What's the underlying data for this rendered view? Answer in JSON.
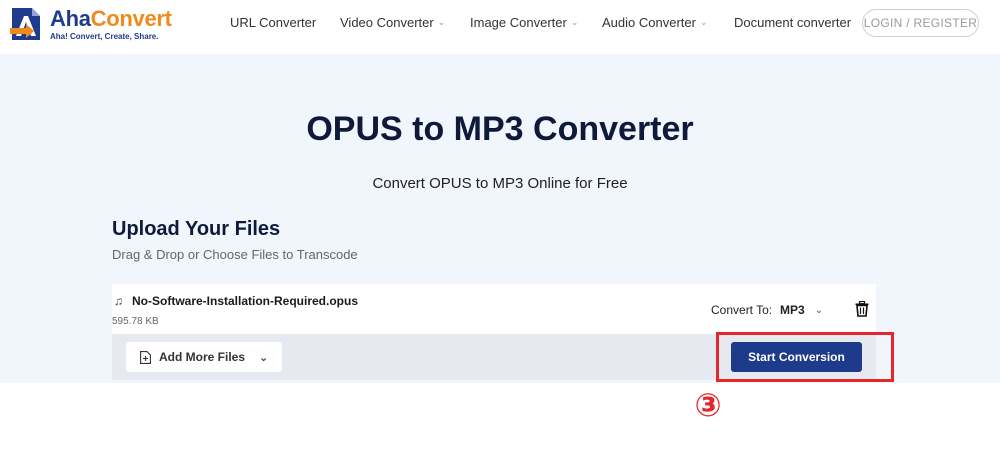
{
  "brand": {
    "name_part1": "Aha",
    "name_part2": "Convert",
    "tagline": "Aha! Convert, Create, Share."
  },
  "nav": {
    "items": [
      {
        "label": "URL Converter",
        "has_dropdown": false
      },
      {
        "label": "Video Converter",
        "has_dropdown": true
      },
      {
        "label": "Image Converter",
        "has_dropdown": true
      },
      {
        "label": "Audio Converter",
        "has_dropdown": true
      },
      {
        "label": "Document converter",
        "has_dropdown": false
      }
    ],
    "login_label": "LOGIN / REGISTER"
  },
  "hero": {
    "title": "OPUS to MP3 Converter",
    "subtitle": "Convert OPUS to MP3 Online for Free"
  },
  "upload": {
    "title": "Upload Your Files",
    "subtitle": "Drag & Drop or Choose Files to Transcode"
  },
  "file": {
    "name": "No-Software-Installation-Required.opus",
    "size": "595.78 KB",
    "convert_to_label": "Convert To:",
    "convert_to_value": "MP3"
  },
  "actions": {
    "add_more_label": "Add More Files",
    "start_label": "Start Conversion"
  },
  "annotation": {
    "step_number": "③"
  },
  "colors": {
    "brand_blue": "#1f3b8c",
    "brand_orange": "#f08a1c",
    "primary_button": "#1e3a8a",
    "hero_background": "#f1f5fc",
    "highlight_red": "#e8252a"
  }
}
